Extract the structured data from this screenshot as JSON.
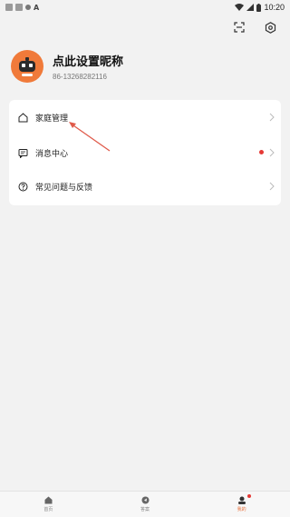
{
  "status_bar": {
    "left_icons": [
      "square-icon",
      "square-icon",
      "circle-icon",
      "a-icon"
    ],
    "a_glyph": "A",
    "time": "10:20",
    "right_icons": [
      "wifi-icon",
      "signal-icon",
      "battery-icon"
    ]
  },
  "header": {
    "actions": [
      "scan-icon",
      "settings-icon"
    ]
  },
  "profile": {
    "nickname": "点此设置昵称",
    "phone": "86-13268282116",
    "avatar_color": "#f07a3a"
  },
  "menu": {
    "items": [
      {
        "label": "家庭管理",
        "icon": "home-icon",
        "has_badge": false
      },
      {
        "label": "消息中心",
        "icon": "message-icon",
        "has_badge": true
      },
      {
        "label": "常见问题与反馈",
        "icon": "help-icon",
        "has_badge": false
      }
    ]
  },
  "annotation": {
    "color": "#e05a4a",
    "target": "家庭管理"
  },
  "tabbar": {
    "tabs": [
      {
        "label": "首页",
        "icon": "home-tab-icon",
        "active": false
      },
      {
        "label": "答案",
        "icon": "answer-tab-icon",
        "active": false
      },
      {
        "label": "我的",
        "icon": "profile-tab-icon",
        "active": true,
        "badge": true
      }
    ],
    "accent": "#e8713c"
  }
}
